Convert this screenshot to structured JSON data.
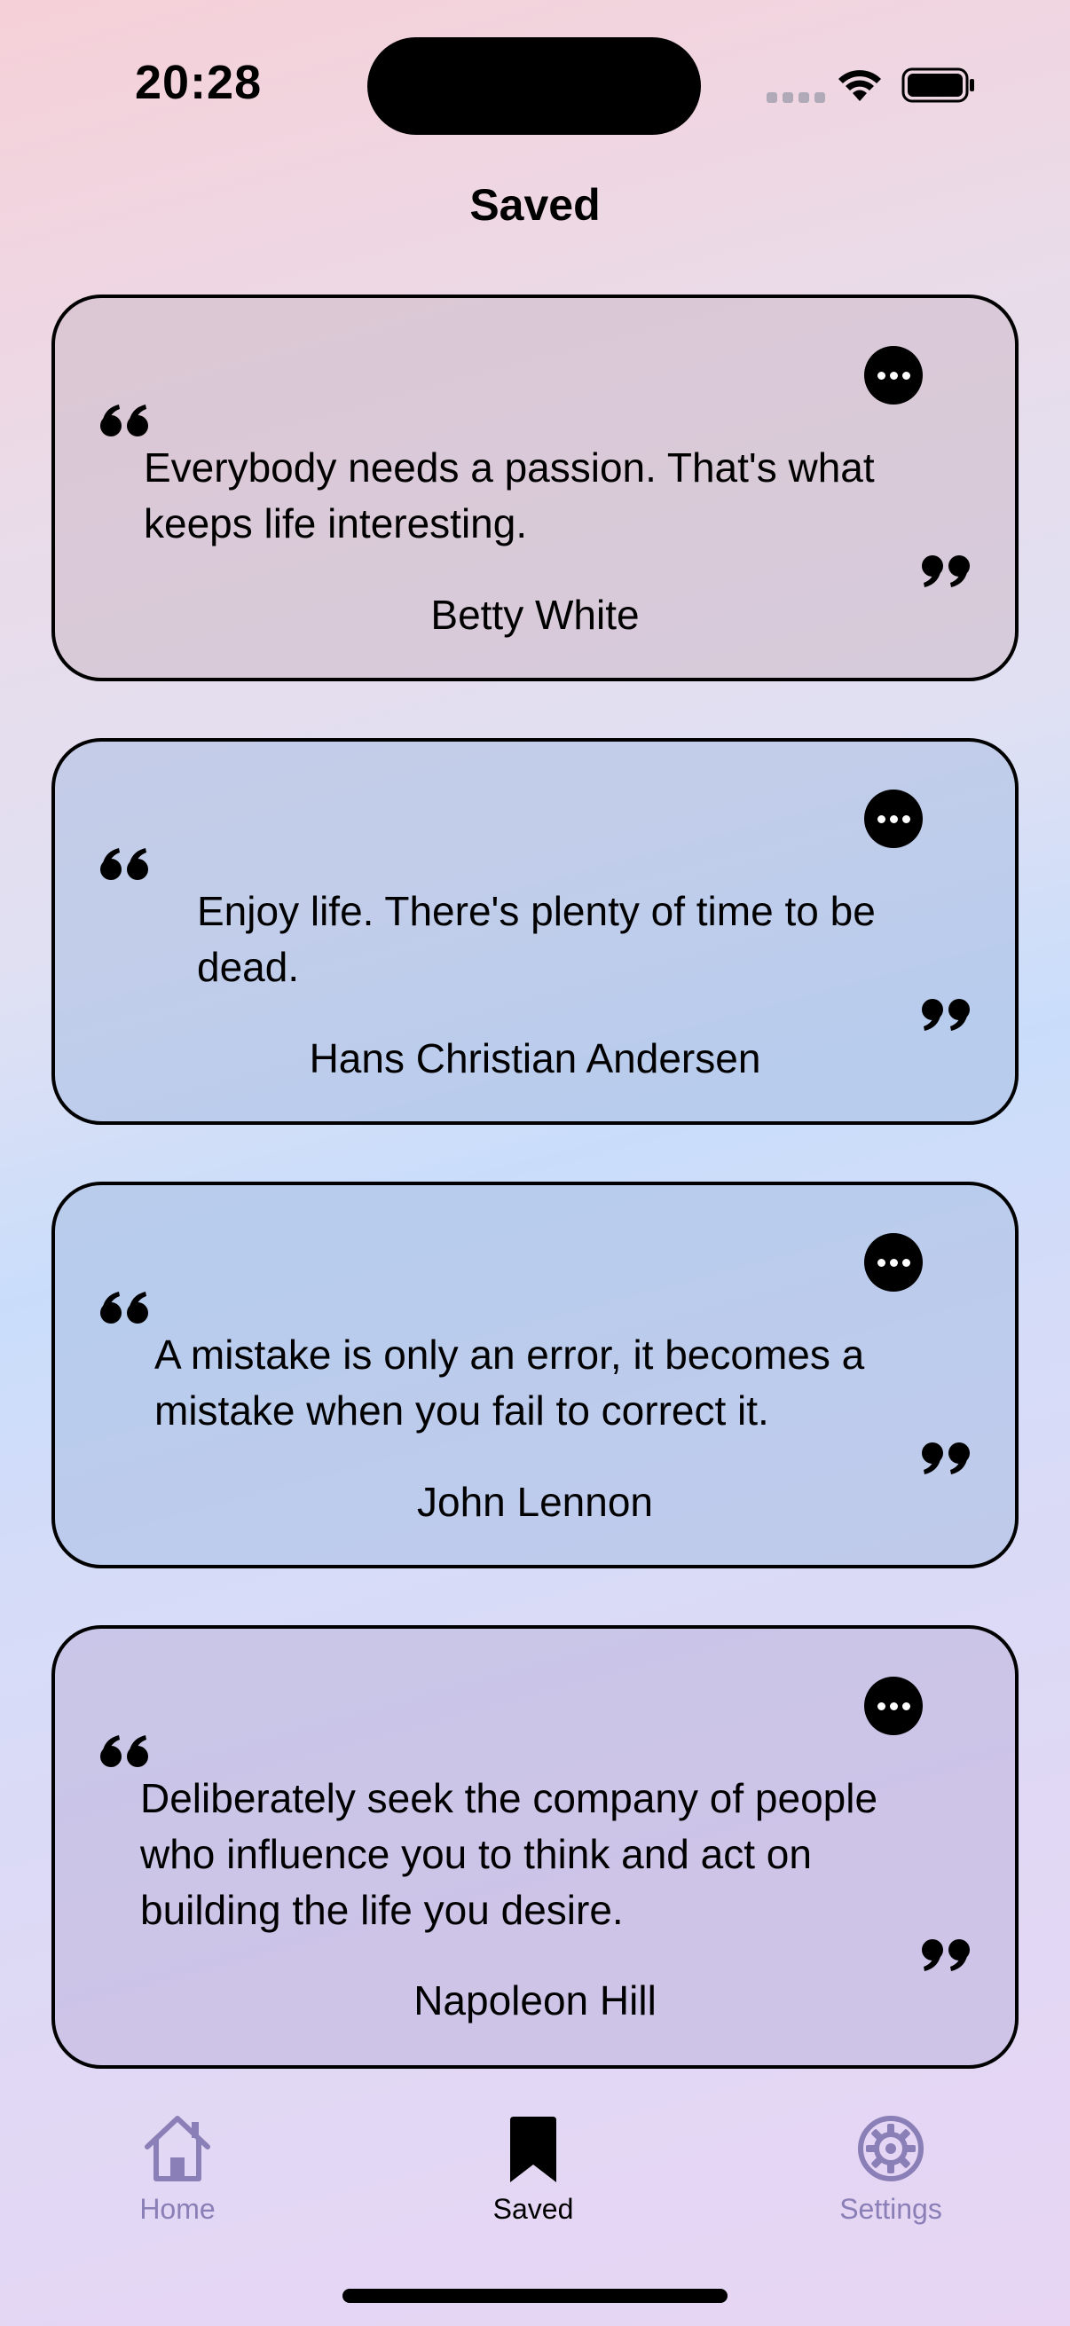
{
  "status_bar": {
    "time": "20:28"
  },
  "page": {
    "title": "Saved"
  },
  "quotes": [
    {
      "text": "Everybody needs a passion. That's what keeps life interesting.",
      "author": "Betty White"
    },
    {
      "text": "Enjoy life. There's plenty of time to be dead.",
      "author": "Hans Christian Andersen"
    },
    {
      "text": "A mistake is only an error, it becomes a mistake when you fail to correct it.",
      "author": "John Lennon"
    },
    {
      "text": "Deliberately seek the company of people who influence you to think and act on building the life you desire.",
      "author": "Napoleon Hill"
    }
  ],
  "tab_bar": {
    "items": [
      {
        "label": "Home",
        "icon": "house-icon"
      },
      {
        "label": "Saved",
        "icon": "bookmark-icon"
      },
      {
        "label": "Settings",
        "icon": "gear-icon"
      }
    ]
  },
  "colors": {
    "tab_active": "#000000",
    "tab_inactive": "#8a7fb6"
  }
}
